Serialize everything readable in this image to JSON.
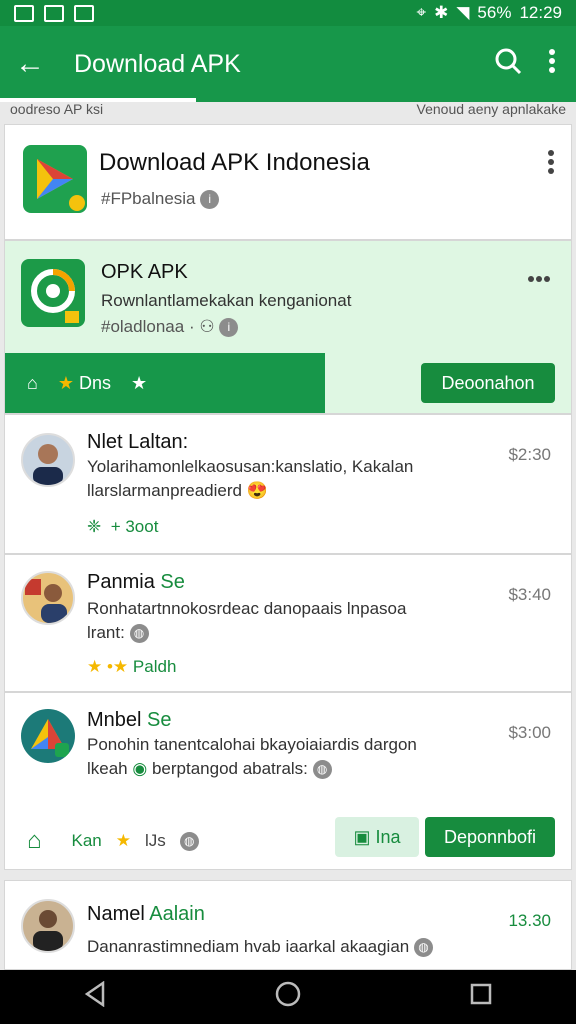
{
  "status": {
    "battery": "56%",
    "time": "12:29"
  },
  "appbar": {
    "back_icon": "arrow-left-icon",
    "title": "Download APK"
  },
  "subbar": {
    "left": "oodreso AP ksi",
    "right": "Venoud aeny apnlakake"
  },
  "card1": {
    "name": "Download APK Indonesia",
    "handle": "#FPbalnesia"
  },
  "card2": {
    "name": "OPK APK",
    "desc": "Rownlantlamekakan kenganionat",
    "meta": "#oladlonaa",
    "bar_label": "Dns",
    "button": "Deoonahon"
  },
  "posts": [
    {
      "name": "Nlet Laltan:",
      "line1": "Yolarihamonlelkaosusan:kanslatio, Kakalan",
      "line2": "llarslarmanpreadierd",
      "tag": "+ 3oot",
      "price": "$2:30"
    },
    {
      "name": "Panmia",
      "name_accent": "Se",
      "line1": "Ronhatartnnokosrdeac danopaais lnpasoa",
      "line2": "lrant:",
      "tag": "Paldh",
      "price": "$3:40"
    },
    {
      "name": "Mnbel",
      "name_accent": "Se",
      "line1": "Ponohin tanentcalohai bkayoiaiardis dargon",
      "line2": "lkeah",
      "line2b": "berptangod abatrals:",
      "bar_label": "Kan",
      "bar_rating": "lJs",
      "btn_light": "Ina",
      "btn_dark": "Deponnbofi",
      "price": "$3:00"
    },
    {
      "name": "Namel",
      "name_accent": "Aalain",
      "line1": "Dananrastimnediam hvab iaarkal akaagian",
      "price": "13.30"
    }
  ],
  "colors": {
    "primary": "#17974a",
    "accent_light": "#d9f1e1",
    "star": "#f5b800"
  }
}
